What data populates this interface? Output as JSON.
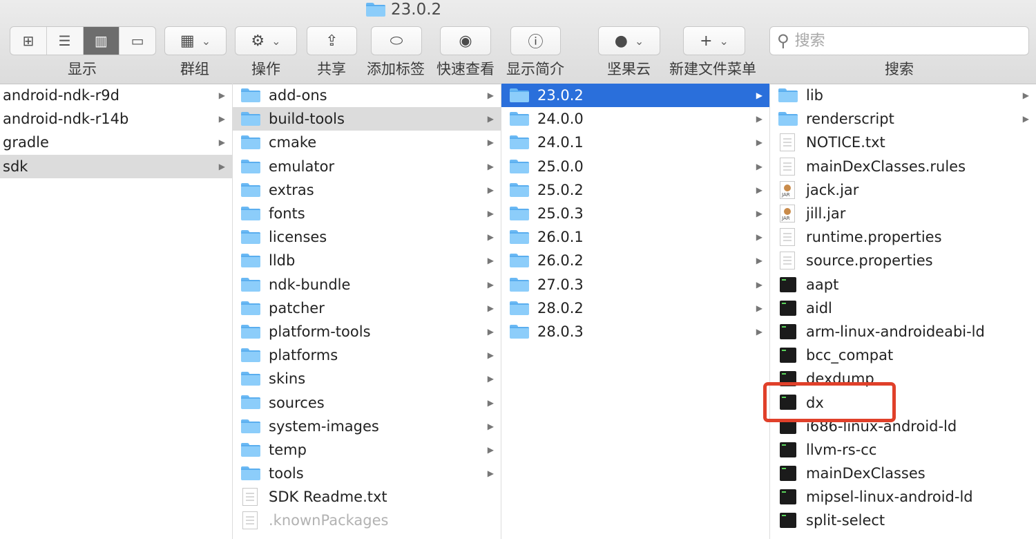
{
  "window": {
    "title": "23.0.2"
  },
  "toolbar": {
    "view_modes": [
      "icon-view-icon",
      "list-view-icon",
      "column-view-icon",
      "gallery-view-icon"
    ],
    "display_label": "显示",
    "group_label": "群组",
    "action_label": "操作",
    "share_label": "共享",
    "tag_label": "添加标签",
    "quicklook_label": "快速查看",
    "info_label": "显示简介",
    "jianguoyun_label": "坚果云",
    "newfile_label": "新建文件菜单",
    "search_label": "搜索",
    "search_placeholder": "搜索"
  },
  "columns": {
    "col1": [
      {
        "name": "android-ndk-r9d",
        "arrow": true
      },
      {
        "name": "android-ndk-r14b",
        "arrow": true
      },
      {
        "name": "gradle",
        "arrow": true
      },
      {
        "name": "sdk",
        "arrow": true,
        "selected": "gray"
      }
    ],
    "col2": [
      {
        "name": "add-ons",
        "icon": "folder",
        "arrow": true
      },
      {
        "name": "build-tools",
        "icon": "folder",
        "arrow": true,
        "selected": "gray"
      },
      {
        "name": "cmake",
        "icon": "folder",
        "arrow": true
      },
      {
        "name": "emulator",
        "icon": "folder",
        "arrow": true
      },
      {
        "name": "extras",
        "icon": "folder",
        "arrow": true
      },
      {
        "name": "fonts",
        "icon": "folder",
        "arrow": true
      },
      {
        "name": "licenses",
        "icon": "folder",
        "arrow": true
      },
      {
        "name": "lldb",
        "icon": "folder",
        "arrow": true
      },
      {
        "name": "ndk-bundle",
        "icon": "folder",
        "arrow": true
      },
      {
        "name": "patcher",
        "icon": "folder",
        "arrow": true
      },
      {
        "name": "platform-tools",
        "icon": "folder",
        "arrow": true
      },
      {
        "name": "platforms",
        "icon": "folder",
        "arrow": true
      },
      {
        "name": "skins",
        "icon": "folder",
        "arrow": true
      },
      {
        "name": "sources",
        "icon": "folder",
        "arrow": true
      },
      {
        "name": "system-images",
        "icon": "folder",
        "arrow": true
      },
      {
        "name": "temp",
        "icon": "folder",
        "arrow": true
      },
      {
        "name": "tools",
        "icon": "folder",
        "arrow": true
      },
      {
        "name": "SDK Readme.txt",
        "icon": "doc"
      },
      {
        "name": ".knownPackages",
        "icon": "doc",
        "dim": true
      }
    ],
    "col3": [
      {
        "name": "23.0.2",
        "icon": "folder",
        "arrow": true,
        "selected": "blue"
      },
      {
        "name": "24.0.0",
        "icon": "folder",
        "arrow": true
      },
      {
        "name": "24.0.1",
        "icon": "folder",
        "arrow": true
      },
      {
        "name": "25.0.0",
        "icon": "folder",
        "arrow": true
      },
      {
        "name": "25.0.2",
        "icon": "folder",
        "arrow": true
      },
      {
        "name": "25.0.3",
        "icon": "folder",
        "arrow": true
      },
      {
        "name": "26.0.1",
        "icon": "folder",
        "arrow": true
      },
      {
        "name": "26.0.2",
        "icon": "folder",
        "arrow": true
      },
      {
        "name": "27.0.3",
        "icon": "folder",
        "arrow": true
      },
      {
        "name": "28.0.2",
        "icon": "folder",
        "arrow": true
      },
      {
        "name": "28.0.3",
        "icon": "folder",
        "arrow": true
      }
    ],
    "col4": [
      {
        "name": "lib",
        "icon": "folder",
        "arrow": true
      },
      {
        "name": "renderscript",
        "icon": "folder",
        "arrow": true
      },
      {
        "name": "NOTICE.txt",
        "icon": "doc"
      },
      {
        "name": "mainDexClasses.rules",
        "icon": "doc"
      },
      {
        "name": "jack.jar",
        "icon": "jar"
      },
      {
        "name": "jill.jar",
        "icon": "jar"
      },
      {
        "name": "runtime.properties",
        "icon": "doc"
      },
      {
        "name": "source.properties",
        "icon": "doc"
      },
      {
        "name": "aapt",
        "icon": "exec"
      },
      {
        "name": "aidl",
        "icon": "exec"
      },
      {
        "name": "arm-linux-androideabi-ld",
        "icon": "exec"
      },
      {
        "name": "bcc_compat",
        "icon": "exec"
      },
      {
        "name": "dexdump",
        "icon": "exec"
      },
      {
        "name": "dx",
        "icon": "exec"
      },
      {
        "name": "i686-linux-android-ld",
        "icon": "exec"
      },
      {
        "name": "llvm-rs-cc",
        "icon": "exec"
      },
      {
        "name": "mainDexClasses",
        "icon": "exec"
      },
      {
        "name": "mipsel-linux-android-ld",
        "icon": "exec"
      },
      {
        "name": "split-select",
        "icon": "exec"
      }
    ]
  },
  "colors": {
    "selection_blue": "#2a6fdb",
    "highlight_red": "#e0402a",
    "folder_blue": "#8ccdfa"
  }
}
